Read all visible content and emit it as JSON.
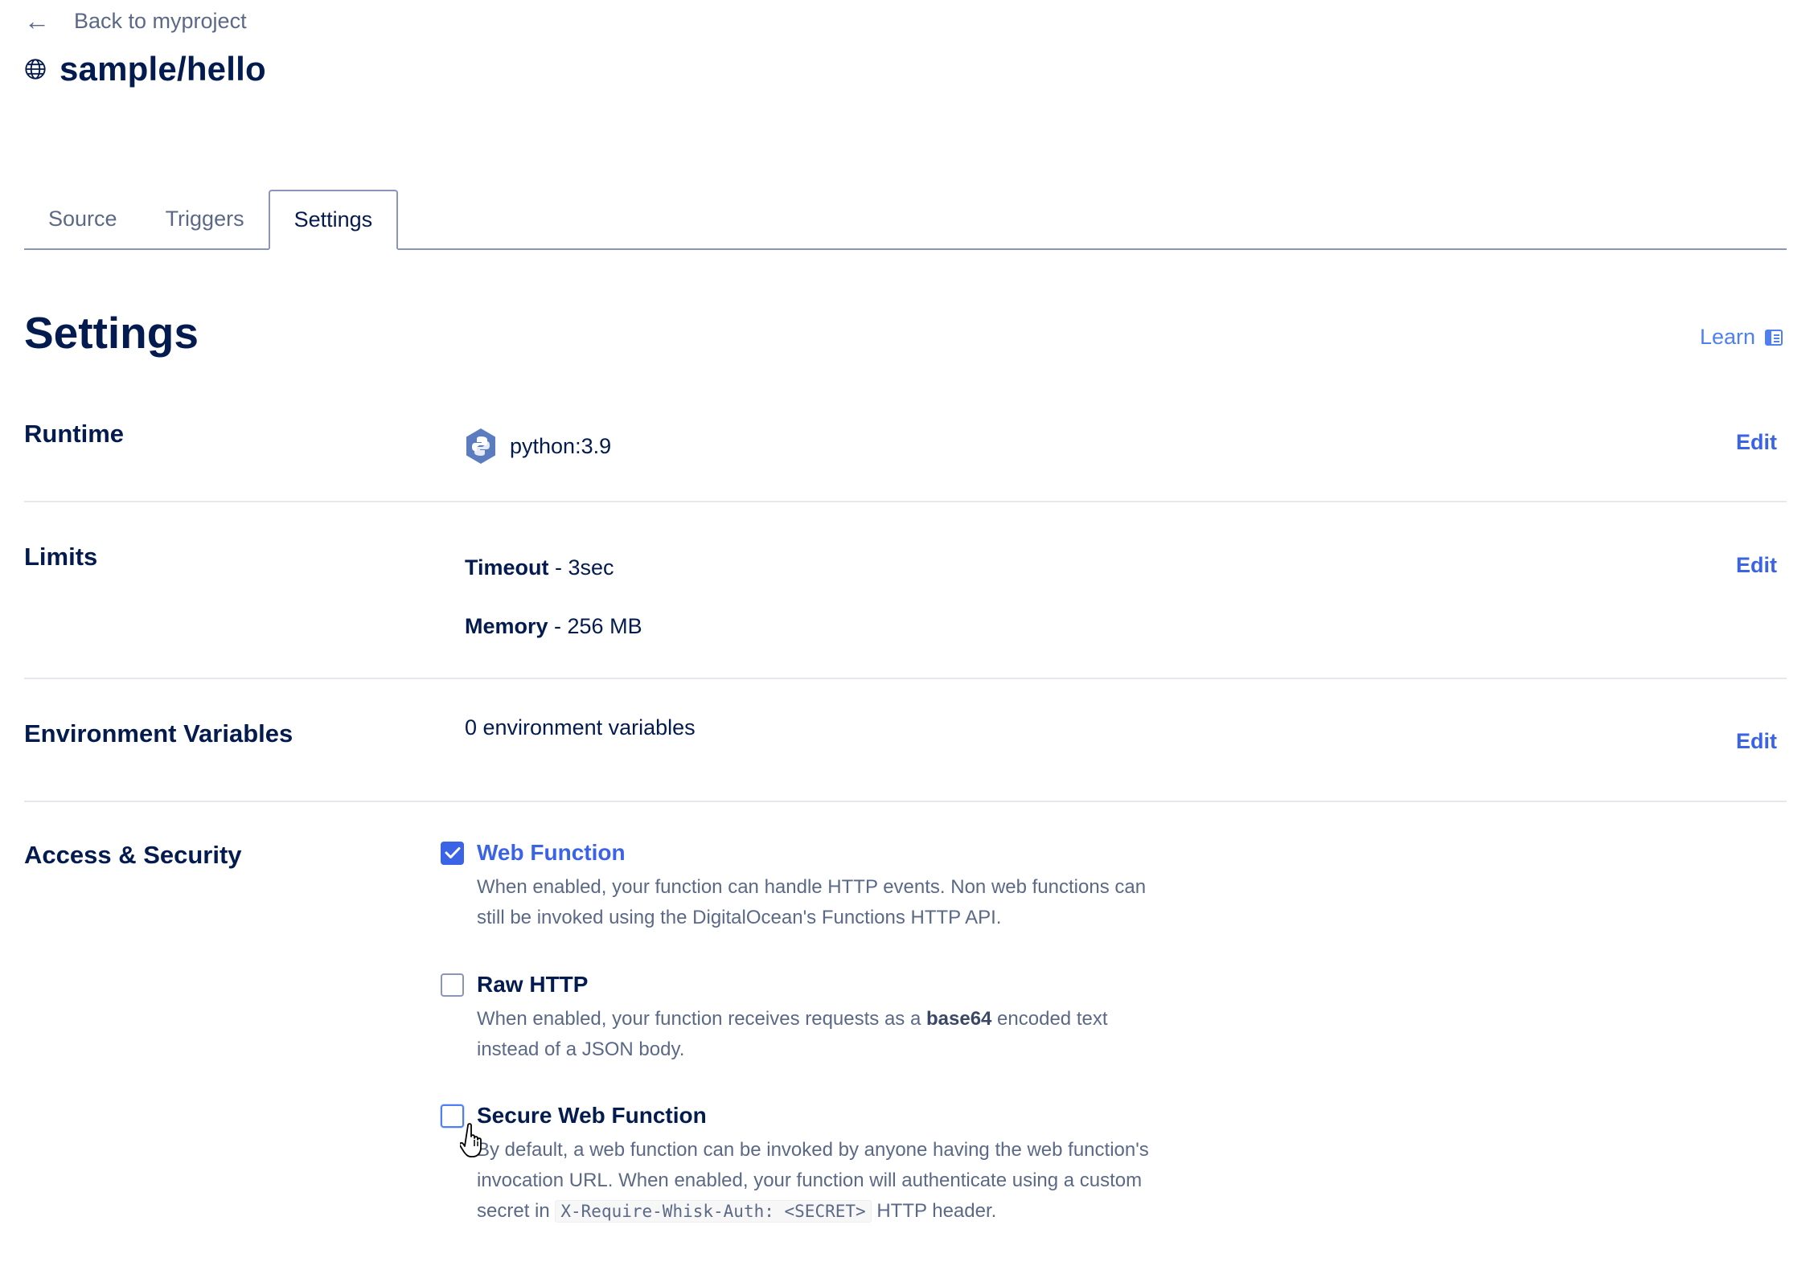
{
  "header": {
    "back_label": "Back to myproject",
    "back_icon": "arrow-left-icon",
    "title_icon": "globe-icon",
    "title": "sample/hello"
  },
  "tabs": [
    {
      "label": "Source",
      "active": false
    },
    {
      "label": "Triggers",
      "active": false
    },
    {
      "label": "Settings",
      "active": true
    }
  ],
  "page": {
    "heading": "Settings",
    "learn_label": "Learn",
    "learn_icon": "book-icon"
  },
  "sections": {
    "runtime": {
      "label": "Runtime",
      "icon": "python-icon",
      "value": "python:3.9",
      "edit_label": "Edit"
    },
    "limits": {
      "label": "Limits",
      "timeout_label": "Timeout",
      "timeout_value": " - 3sec",
      "memory_label": "Memory",
      "memory_value": " - 256 MB",
      "edit_label": "Edit"
    },
    "env": {
      "label": "Environment Variables",
      "value": "0 environment variables",
      "edit_label": "Edit"
    },
    "access": {
      "label": "Access & Security",
      "options": [
        {
          "title": "Web Function",
          "checked": true,
          "desc": "When enabled, your function can handle HTTP events. Non web functions can still be invoked using the DigitalOcean's Functions HTTP API."
        },
        {
          "title": "Raw HTTP",
          "checked": false,
          "desc_before": "When enabled, your function receives requests as a ",
          "desc_bold": "base64",
          "desc_after": " encoded text instead of a JSON body."
        },
        {
          "title": "Secure Web Function",
          "checked": false,
          "desc_before": "By default, a web function can be invoked by anyone having the web function's invocation URL. When enabled, your function will authenticate using a custom secret in ",
          "desc_code": "X-Require-Whisk-Auth: <SECRET>",
          "desc_after": " HTTP header."
        }
      ]
    }
  },
  "colors": {
    "primary_text": "#031b4e",
    "secondary_text": "#5b6987",
    "accent": "#3b63e6",
    "link": "#4f7ff0"
  }
}
